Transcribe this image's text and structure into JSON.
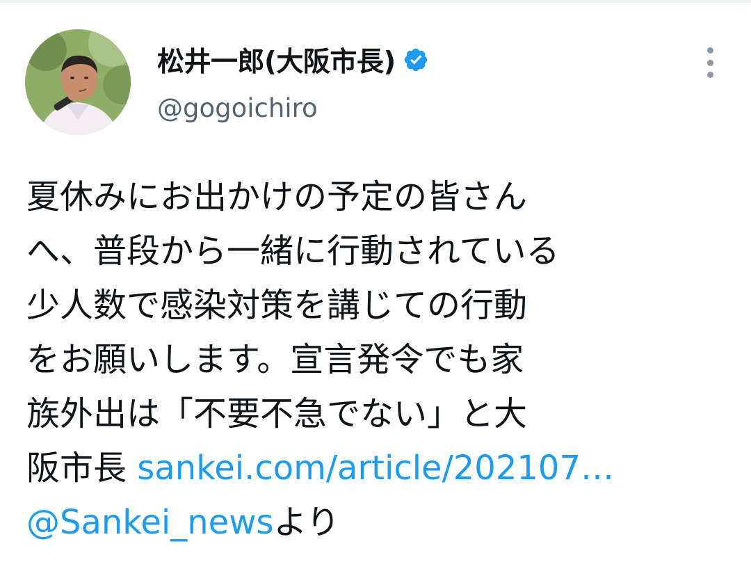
{
  "tweet": {
    "author": {
      "display_name": "松井一郎(大阪市長)",
      "handle": "@gogoichiro",
      "verified": true,
      "avatar_icon": "user-photo-avatar"
    },
    "more_icon": "more-vertical-icon",
    "text_lines": [
      "夏休みにお出かけの予定の皆さん",
      "へ、普段から一緒に行動されている",
      "少人数で感染対策を講じての行動",
      "をお願いします。宣言発令でも家",
      "族外出は「不要不急でない」と大"
    ],
    "last_line_prefix": "阪市長 ",
    "link_url": "sankei.com/article/202107…",
    "mention": "@Sankei_news",
    "mention_suffix": "より"
  },
  "colors": {
    "link": "#1d9bf0",
    "verified_badge": "#1d9bf0",
    "secondary_text": "#536471"
  }
}
